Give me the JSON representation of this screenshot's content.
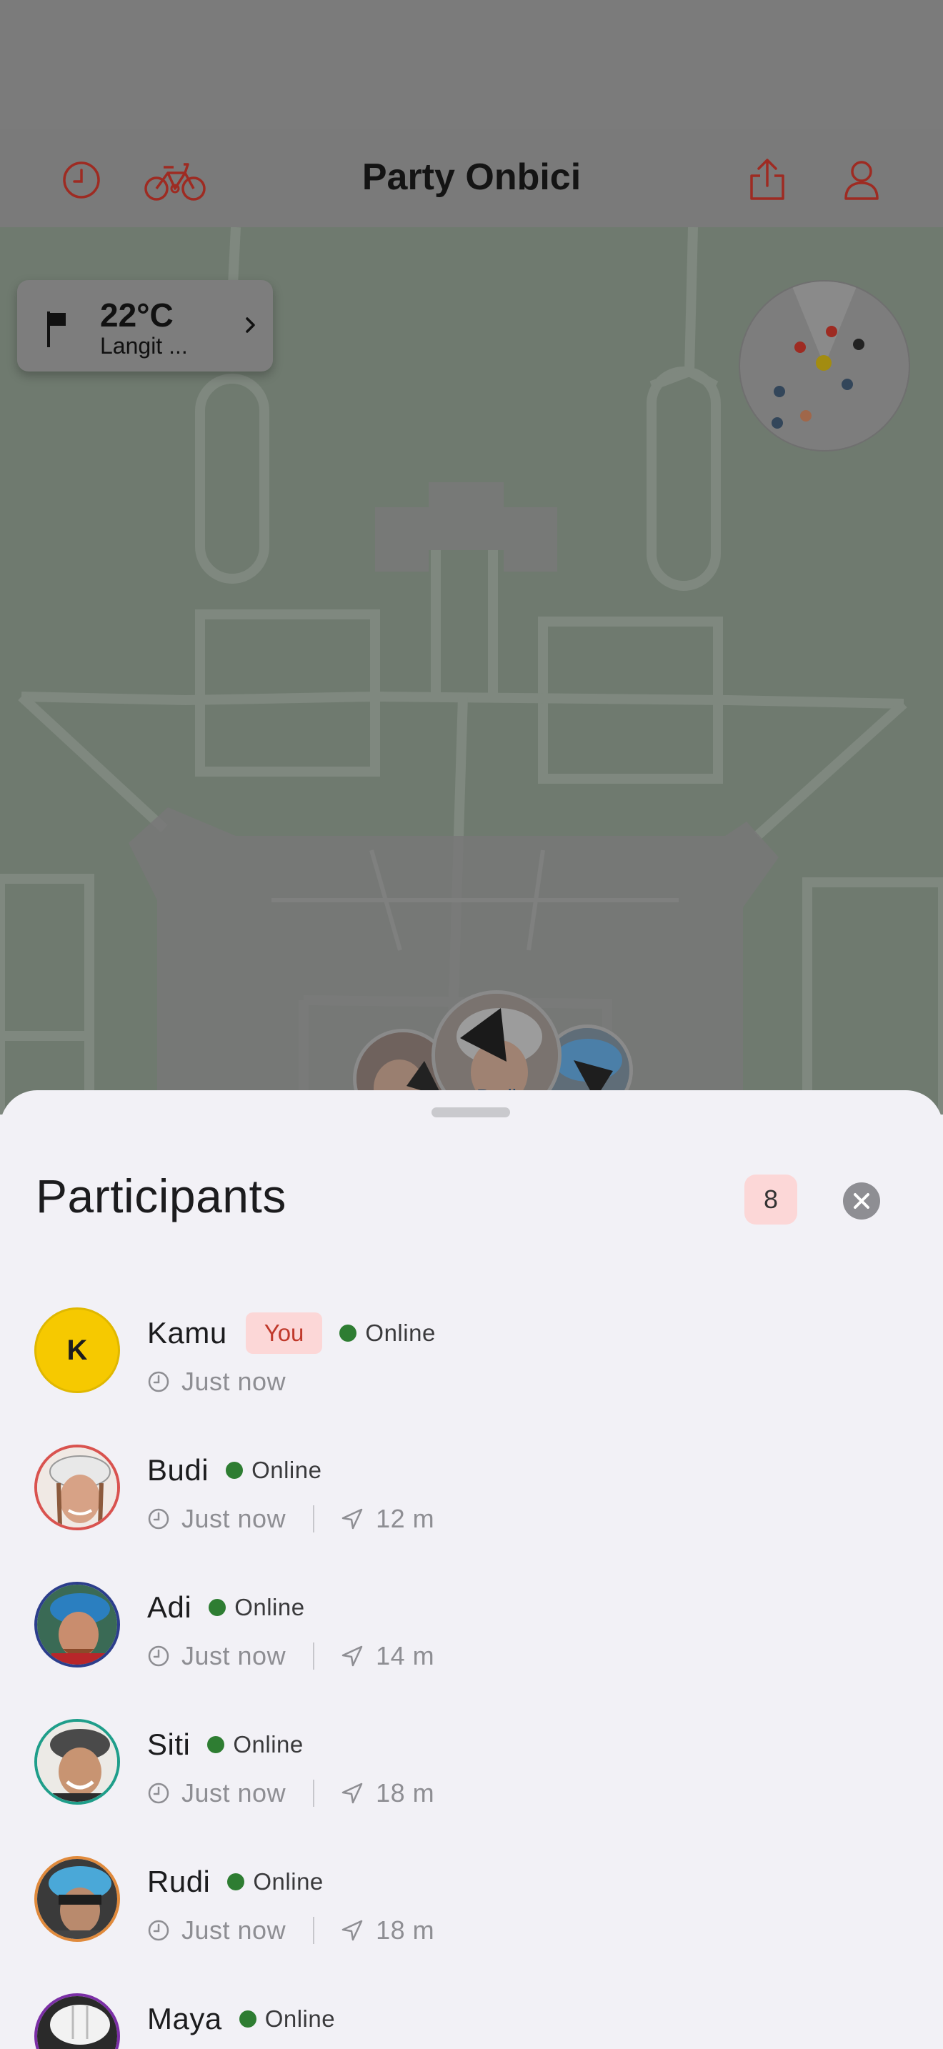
{
  "header": {
    "title": "Party Onbici",
    "icons": [
      "history-icon",
      "bicycle-icon",
      "share-icon",
      "profile-icon"
    ]
  },
  "weather": {
    "temperature": "22°C",
    "condition": "Langit ..."
  },
  "map": {
    "pin_label": "Budi"
  },
  "sheet": {
    "title": "Participants",
    "count": "8"
  },
  "participants": [
    {
      "name": "Kamu",
      "initial": "K",
      "is_you": true,
      "you_label": "You",
      "status": "Online",
      "last_seen": "Just now",
      "distance": ""
    },
    {
      "name": "Budi",
      "status": "Online",
      "last_seen": "Just now",
      "distance": "12 m"
    },
    {
      "name": "Adi",
      "status": "Online",
      "last_seen": "Just now",
      "distance": "14 m"
    },
    {
      "name": "Siti",
      "status": "Online",
      "last_seen": "Just now",
      "distance": "18 m"
    },
    {
      "name": "Rudi",
      "status": "Online",
      "last_seen": "Just now",
      "distance": "18 m"
    },
    {
      "name": "Maya",
      "status": "Online",
      "last_seen": "",
      "distance": ""
    }
  ],
  "colors": {
    "accent": "#c0392b",
    "online": "#2e7d32",
    "badge_bg": "#fcd7d7",
    "you_avatar": "#f6c900"
  }
}
